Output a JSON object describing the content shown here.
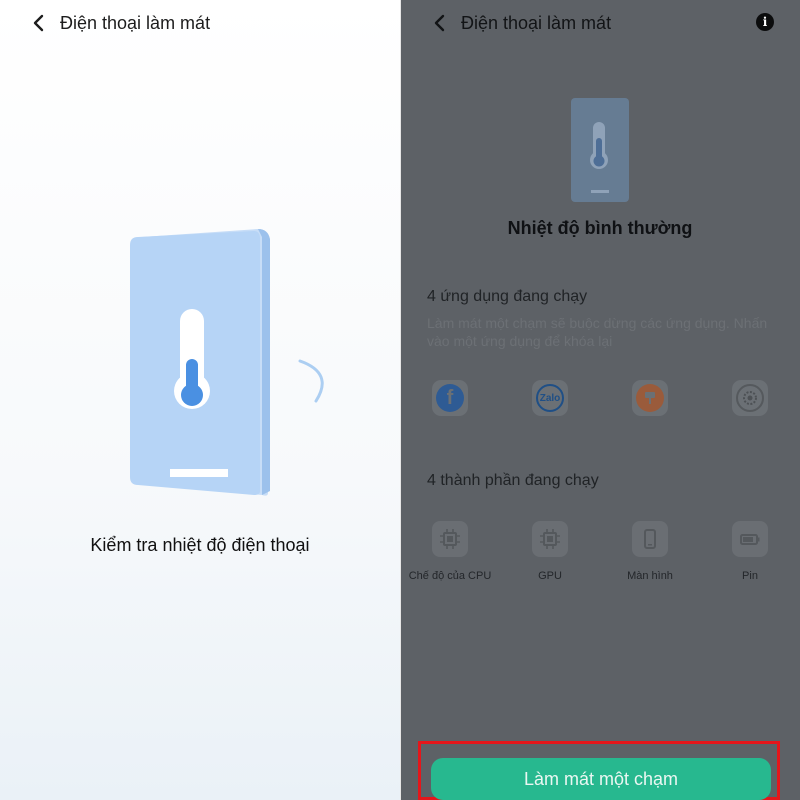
{
  "left": {
    "header": {
      "title": "Điện thoại làm mát"
    },
    "check_text": "Kiểm tra nhiệt độ điện thoại"
  },
  "right": {
    "header": {
      "title": "Điện thoại làm mát",
      "info_icon": "i"
    },
    "status": "Nhiệt độ bình thường",
    "apps_section": {
      "title": "4 ứng dụng đang chạy",
      "description": "Làm mát một chạm sẽ buộc dừng các ứng dụng. Nhấn vào một ứng dụng để khóa lại",
      "apps": [
        {
          "name": "facebook-icon",
          "glyph": "f"
        },
        {
          "name": "zalo-icon",
          "glyph": "Zalo"
        },
        {
          "name": "orange-app-icon",
          "glyph": ""
        },
        {
          "name": "settings-app-icon",
          "glyph": ""
        }
      ]
    },
    "components_section": {
      "title": "4 thành phần đang chạy",
      "items": [
        {
          "label": "Chế độ của CPU",
          "icon": "cpu-chip-icon"
        },
        {
          "label": "GPU",
          "icon": "gpu-chip-icon"
        },
        {
          "label": "Màn hình",
          "icon": "screen-icon"
        },
        {
          "label": "Pin",
          "icon": "battery-icon"
        }
      ]
    },
    "cta_label": "Làm mát một chạm"
  },
  "colors": {
    "accent": "#27b88f",
    "highlight_border": "#e5161b",
    "overlay": "#5d6166",
    "phone_blue": "#b3d3f7",
    "thermo_blue": "#4a90e2"
  }
}
